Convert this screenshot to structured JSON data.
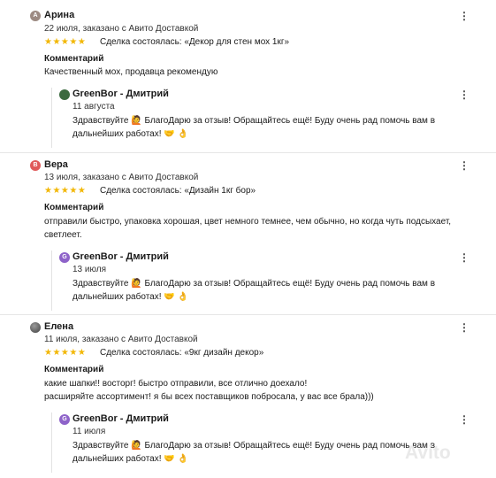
{
  "reviews": [
    {
      "avatar_letter": "А",
      "avatar_color": "#9c8a82",
      "author": "Арина",
      "meta": "22 июля, заказано с Авито Доставкой",
      "stars": "★★★★★",
      "deal": "Сделка состоялась: «Декор для стен мох 1кг»",
      "comment_title": "Комментарий",
      "comment": "Качественный мох, продавца рекомендую",
      "reply": {
        "avatar_letter": "",
        "avatar_color": "#3b6a3f",
        "author": "GreenBor - Дмитрий",
        "date": "11 августа",
        "text": "Здравствуйте 🙋 БлагоДарю за отзыв! Обращайтесь ещё! Буду очень рад помочь вам в дальнейших работах! 🤝 👌"
      }
    },
    {
      "avatar_letter": "В",
      "avatar_color": "#e05a5a",
      "author": "Вера",
      "meta": "13 июля, заказано с Авито Доставкой",
      "stars": "★★★★★",
      "deal": "Сделка состоялась: «Дизайн 1кг бор»",
      "comment_title": "Комментарий",
      "comment": "отправили быстро, упаковка хорошая, цвет немного темнее, чем обычно, но когда чуть подсыхает, светлеет.",
      "reply": {
        "avatar_letter": "G",
        "avatar_color": "#8e63c9",
        "author": "GreenBor - Дмитрий",
        "date": "13 июля",
        "text": "Здравствуйте 🙋 БлагоДарю за отзыв! Обращайтесь ещё! Буду очень рад помочь вам в дальнейших работах! 🤝 👌"
      }
    },
    {
      "avatar_letter": "",
      "avatar_color": "#6b6b6b",
      "author": "Елена",
      "meta": "11 июля, заказано с Авито Доставкой",
      "stars": "★★★★★",
      "deal": "Сделка состоялась: «9кг дизайн декор»",
      "comment_title": "Комментарий",
      "comment_line1": "какие шапки!! восторг! быстро отправили, все отлично доехало!",
      "comment_line2": "расширяйте ассортимент! я бы всех поставщиков побросала, у вас все брала)))",
      "reply": {
        "avatar_letter": "G",
        "avatar_color": "#8e63c9",
        "author": "GreenBor - Дмитрий",
        "date": "11 июля",
        "text": "Здравствуйте 🙋 БлагоДарю за отзыв! Обращайтесь ещё! Буду очень рад помочь вам в дальнейших работах! 🤝 👌"
      }
    }
  ],
  "menu_icon": "⋮",
  "watermark": "Avito"
}
